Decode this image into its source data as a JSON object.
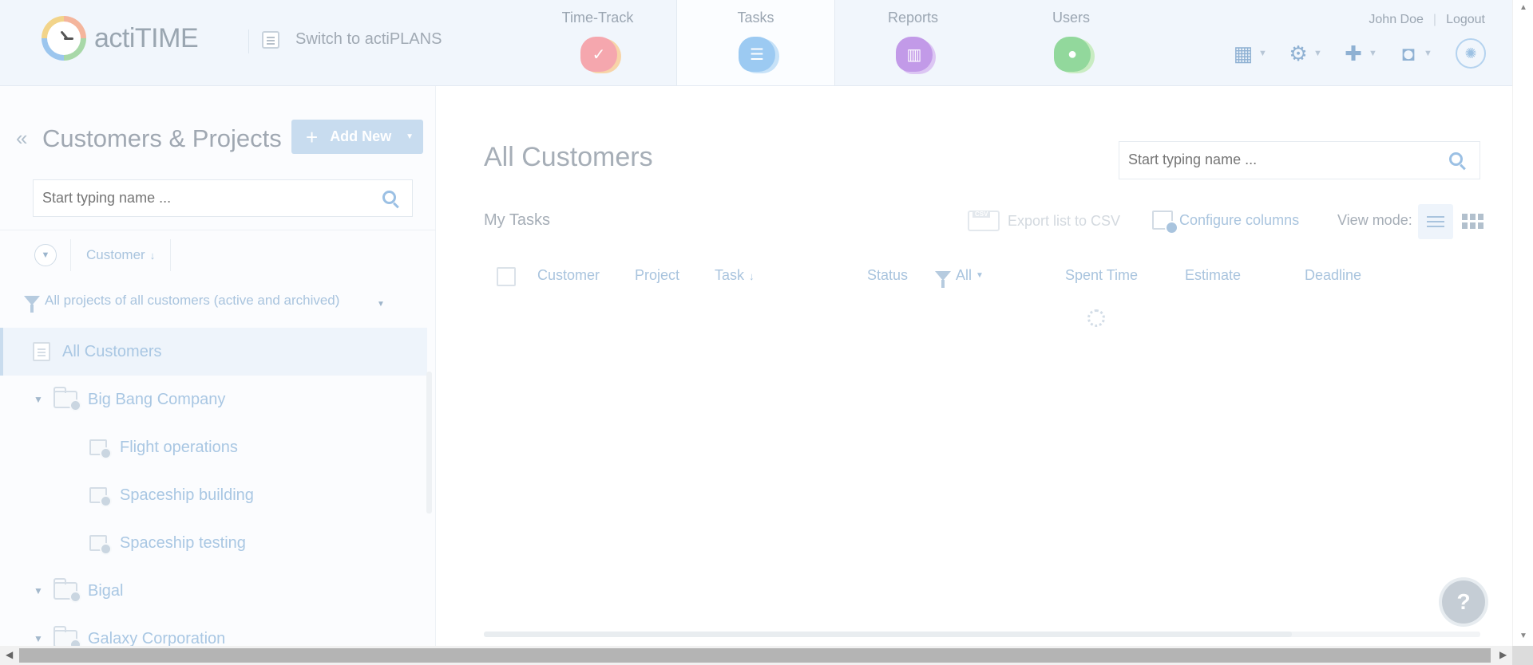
{
  "header": {
    "logo_text": "actiTIME",
    "switch_label": "Switch to actiPLANS",
    "nav": [
      {
        "label": "Time-Track",
        "color": "#f5a7ae"
      },
      {
        "label": "Tasks",
        "color": "#9ccaf2"
      },
      {
        "label": "Reports",
        "color": "#c29ae8"
      },
      {
        "label": "Users",
        "color": "#92d89c"
      }
    ],
    "user_name": "John Doe",
    "logout_label": "Logout",
    "separator": "|"
  },
  "left_panel": {
    "title": "Customers & Projects",
    "add_new_label": "Add New",
    "search_placeholder": "Start typing name ...",
    "sort_label": "Customer",
    "filter_label": "All projects of all customers (active and archived)",
    "tree": [
      {
        "label": "All Customers",
        "type": "all"
      },
      {
        "label": "Big Bang Company",
        "type": "customer"
      },
      {
        "label": "Flight operations",
        "type": "project"
      },
      {
        "label": "Spaceship building",
        "type": "project"
      },
      {
        "label": "Spaceship testing",
        "type": "project"
      },
      {
        "label": "Bigal",
        "type": "customer"
      },
      {
        "label": "Galaxy Corporation",
        "type": "customer"
      }
    ]
  },
  "main": {
    "title": "All Customers",
    "search_placeholder": "Start typing name ...",
    "section_label": "My Tasks",
    "export_label": "Export list to CSV",
    "configure_label": "Configure columns",
    "view_mode_label": "View mode:",
    "columns": {
      "customer": "Customer",
      "project": "Project",
      "task": "Task",
      "status": "Status",
      "status_filter": "All",
      "spent_time": "Spent Time",
      "estimate": "Estimate",
      "deadline": "Deadline"
    },
    "help_label": "?"
  }
}
